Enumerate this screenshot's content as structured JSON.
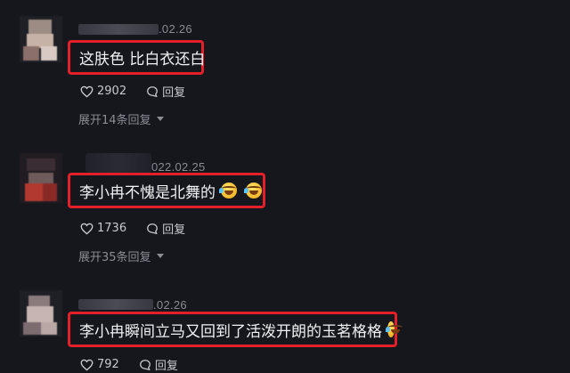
{
  "comments": [
    {
      "date": ".02.26",
      "text": "这肤色 比白衣还白",
      "likes": "2902",
      "reply_label": "回复",
      "expand_label": "展开14条回复",
      "emojis": []
    },
    {
      "date": "022.02.25",
      "text": "李小冉不愧是北舞的",
      "likes": "1736",
      "reply_label": "回复",
      "expand_label": "展开35条回复",
      "emojis": [
        "laughing-tears-emoji",
        "laughing-tears-emoji"
      ]
    },
    {
      "date": ".02.26",
      "text": "李小冉瞬间立马又回到了活泼开朗的玉茗格格",
      "likes": "792",
      "reply_label": "回复",
      "expand_label": "",
      "emojis": [
        "laughing-tears-emoji"
      ]
    }
  ],
  "colors": {
    "background": "#16171d",
    "highlight_border": "#e3202a",
    "meta_text": "#8a8b93"
  }
}
